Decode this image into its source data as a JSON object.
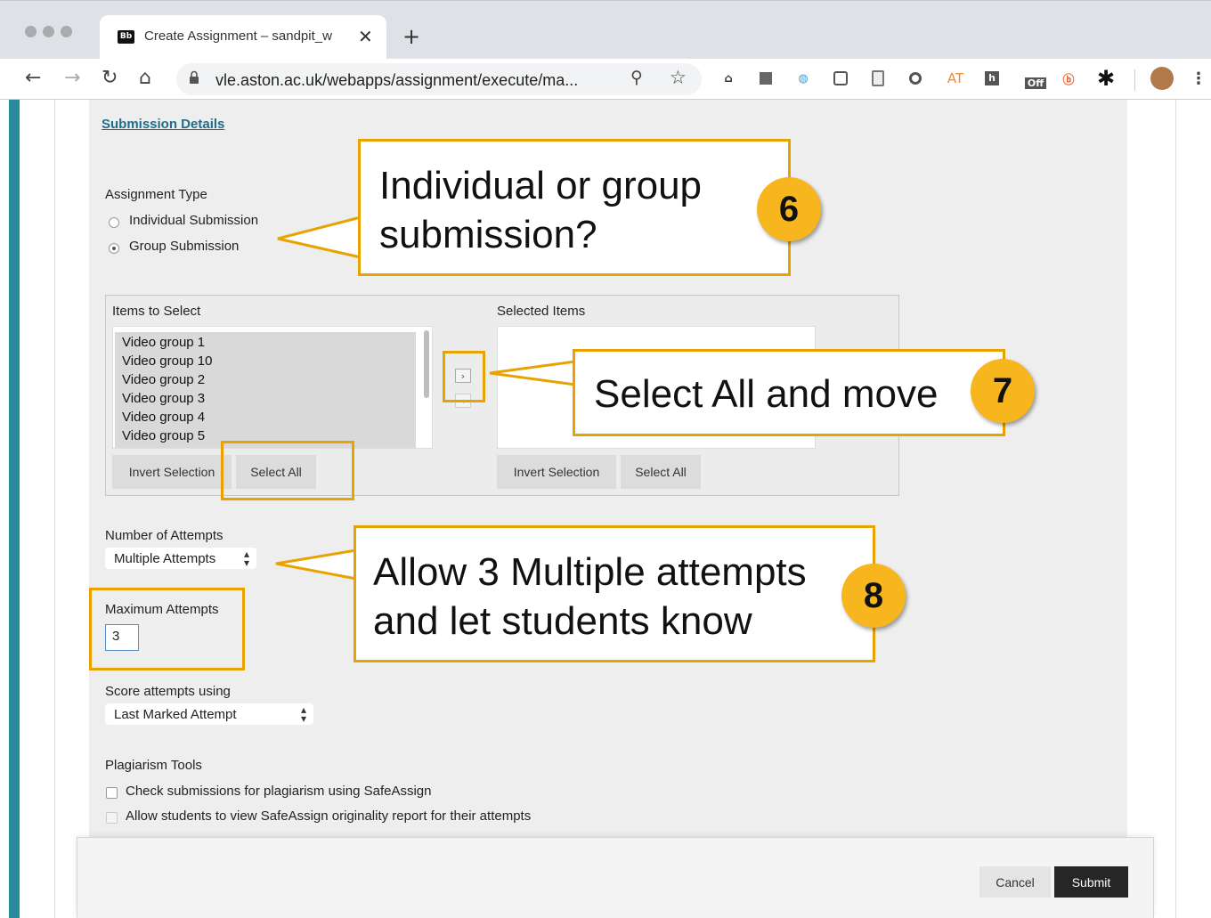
{
  "browser": {
    "tab_title": "Create Assignment – sandpit_w",
    "tab_favicon_text": "Bb",
    "url": "vle.aston.ac.uk/webapps/assignment/execute/ma...",
    "extensions": [
      "library-icon",
      "flag-icon",
      "globe-icon",
      "lightbulb-icon",
      "page-icon",
      "circle-icon",
      "at-icon",
      "h-icon",
      "off-icon",
      "b-icon",
      "asterisk-icon",
      "profile-avatar"
    ],
    "ext_at_label": "AT",
    "ext_off_label": "Off"
  },
  "form": {
    "section_link": "Submission Details",
    "assignment_type_label": "Assignment Type",
    "radio_individual": "Individual Submission",
    "radio_group": "Group Submission",
    "selected_type": "Group Submission",
    "items_to_select_label": "Items to Select",
    "selected_items_label": "Selected Items",
    "items": [
      "Video group 1",
      "Video group 10",
      "Video group 2",
      "Video group 3",
      "Video group 4",
      "Video group 5"
    ],
    "invert_selection": "Invert Selection",
    "select_all": "Select All",
    "attempts_label": "Number of Attempts",
    "attempts_value": "Multiple Attempts",
    "max_attempts_label": "Maximum Attempts",
    "max_attempts_value": "3",
    "score_label": "Score attempts using",
    "score_value": "Last Marked Attempt",
    "plagiarism_label": "Plagiarism Tools",
    "plag_option_1": "Check submissions for plagiarism using SafeAssign",
    "plag_option_2": "Allow students to view SafeAssign originality report for their attempts"
  },
  "footer": {
    "cancel": "Cancel",
    "submit": "Submit"
  },
  "annotations": {
    "callout_6_line1": "Individual or group",
    "callout_6_line2": "submission?",
    "badge_6": "6",
    "callout_7": "Select All and move",
    "badge_7": "7",
    "callout_8_line1": "Allow 3 Multiple attempts",
    "callout_8_line2": "and let students know",
    "badge_8": "8",
    "accent_color": "#e8a300",
    "badge_color": "#f7b51e"
  }
}
